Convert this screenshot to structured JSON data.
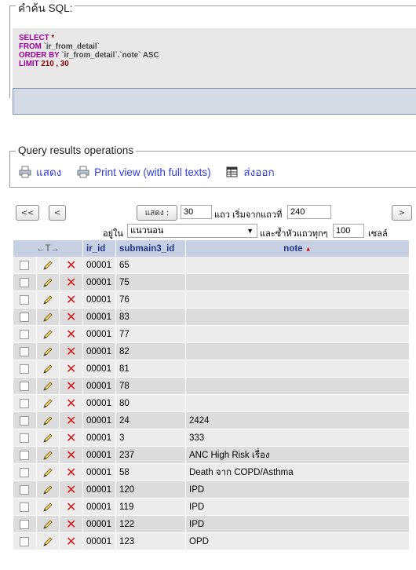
{
  "sql_section": {
    "legend": "คำค้น SQL:",
    "lines": [
      {
        "kw": "SELECT",
        "rest": " *"
      },
      {
        "kw": "FROM",
        "rest": " `ir_from_detail`"
      },
      {
        "kw": "ORDER BY",
        "rest": " `ir_from_detail`.`note` ASC"
      },
      {
        "kw": "LIMIT",
        "rest": " 210 , 30"
      }
    ]
  },
  "ops_section": {
    "legend": "Query results operations",
    "show_label": "แสดง",
    "print_label": "Print view (with full texts)",
    "export_label": "ส่งออก"
  },
  "nav": {
    "first_btn": "<<",
    "prev_btn": "<",
    "next_btn": ">",
    "show_btn": "แสดง :",
    "rows_value": "30",
    "start_label": "แถว เริ่มจากแถวที่",
    "start_value": "240",
    "mode_label": "อยู่ใน",
    "mode_value": "แนวนอน",
    "repeat_label": "และซ้ำหัวแถวทุกๆ",
    "repeat_value": "100",
    "cells_label": "เซลล์"
  },
  "table": {
    "arrows": "←T→",
    "headers": [
      "ir_id",
      "submain3_id",
      "note"
    ],
    "rows": [
      {
        "ir_id": "00001",
        "submain3_id": "65",
        "note": ""
      },
      {
        "ir_id": "00001",
        "submain3_id": "75",
        "note": ""
      },
      {
        "ir_id": "00001",
        "submain3_id": "76",
        "note": ""
      },
      {
        "ir_id": "00001",
        "submain3_id": "83",
        "note": ""
      },
      {
        "ir_id": "00001",
        "submain3_id": "77",
        "note": ""
      },
      {
        "ir_id": "00001",
        "submain3_id": "82",
        "note": ""
      },
      {
        "ir_id": "00001",
        "submain3_id": "81",
        "note": ""
      },
      {
        "ir_id": "00001",
        "submain3_id": "78",
        "note": ""
      },
      {
        "ir_id": "00001",
        "submain3_id": "80",
        "note": ""
      },
      {
        "ir_id": "00001",
        "submain3_id": "24",
        "note": "2424"
      },
      {
        "ir_id": "00001",
        "submain3_id": "3",
        "note": "333"
      },
      {
        "ir_id": "00001",
        "submain3_id": "237",
        "note": "ANC High Risk เรื่อง"
      },
      {
        "ir_id": "00001",
        "submain3_id": "58",
        "note": "Death จาก COPD/Asthma"
      },
      {
        "ir_id": "00001",
        "submain3_id": "120",
        "note": "IPD"
      },
      {
        "ir_id": "00001",
        "submain3_id": "119",
        "note": "IPD"
      },
      {
        "ir_id": "00001",
        "submain3_id": "122",
        "note": "IPD"
      },
      {
        "ir_id": "00001",
        "submain3_id": "123",
        "note": "OPD"
      }
    ]
  }
}
